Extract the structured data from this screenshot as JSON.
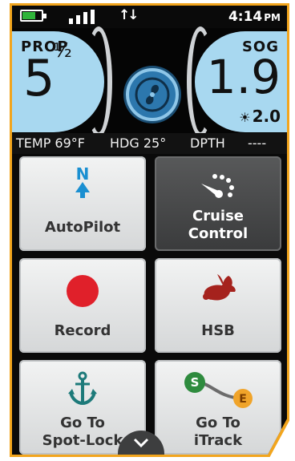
{
  "status": {
    "time": "4:14",
    "ampm": "PM",
    "battery_level": 0.7,
    "signal_bars": 4
  },
  "gauges": {
    "prop": {
      "label": "PROP",
      "value": "5",
      "fraction": "½"
    },
    "sog": {
      "label": "SOG",
      "value": "1.9",
      "sub_value": "2.0"
    },
    "center_icon": "propeller-icon"
  },
  "infobar": {
    "temp": "TEMP 69°F",
    "hdg": "HDG 25°",
    "depth_label": "DPTH",
    "depth_value": "----"
  },
  "tiles": [
    {
      "id": "autopilot",
      "label": "AutoPilot",
      "icon": "north-arrow-icon"
    },
    {
      "id": "cruise-control",
      "label_line1": "Cruise",
      "label_line2": "Control",
      "icon": "speedometer-icon",
      "active": true
    },
    {
      "id": "record",
      "label": "Record",
      "icon": "record-dot-icon"
    },
    {
      "id": "hsb",
      "label": "HSB",
      "icon": "rabbit-icon"
    },
    {
      "id": "spot-lock",
      "label_line1": "Go To",
      "label_line2": "Spot-Lock",
      "icon": "anchor-icon"
    },
    {
      "id": "itrack",
      "label_line1": "Go To",
      "label_line2": "iTrack",
      "icon": "track-path-icon",
      "start_marker": "S",
      "end_marker": "E"
    }
  ],
  "colors": {
    "frame": "#f2a51d",
    "gauge_bg": "#a8d8f0",
    "record_red": "#e0202a",
    "autopilot_blue": "#1a8fd1",
    "anchor_teal": "#1d7a7a",
    "rabbit_red": "#a5221d"
  }
}
